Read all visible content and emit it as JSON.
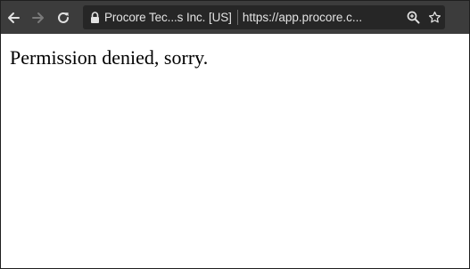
{
  "browser": {
    "site_identity": "Procore Tec...s Inc. [US]",
    "url": "https://app.procore.c...",
    "icons": {
      "back": "arrow-left-icon",
      "forward": "arrow-right-icon",
      "reload": "reload-icon",
      "lock": "lock-icon",
      "zoom": "zoom-icon",
      "bookmark": "star-icon"
    },
    "colors": {
      "toolbar": "#3c3c3c",
      "omnibox": "#262626",
      "text": "#e2e2e2",
      "forward_disabled": "#7a7a7a"
    }
  },
  "page": {
    "message": "Permission denied, sorry."
  }
}
